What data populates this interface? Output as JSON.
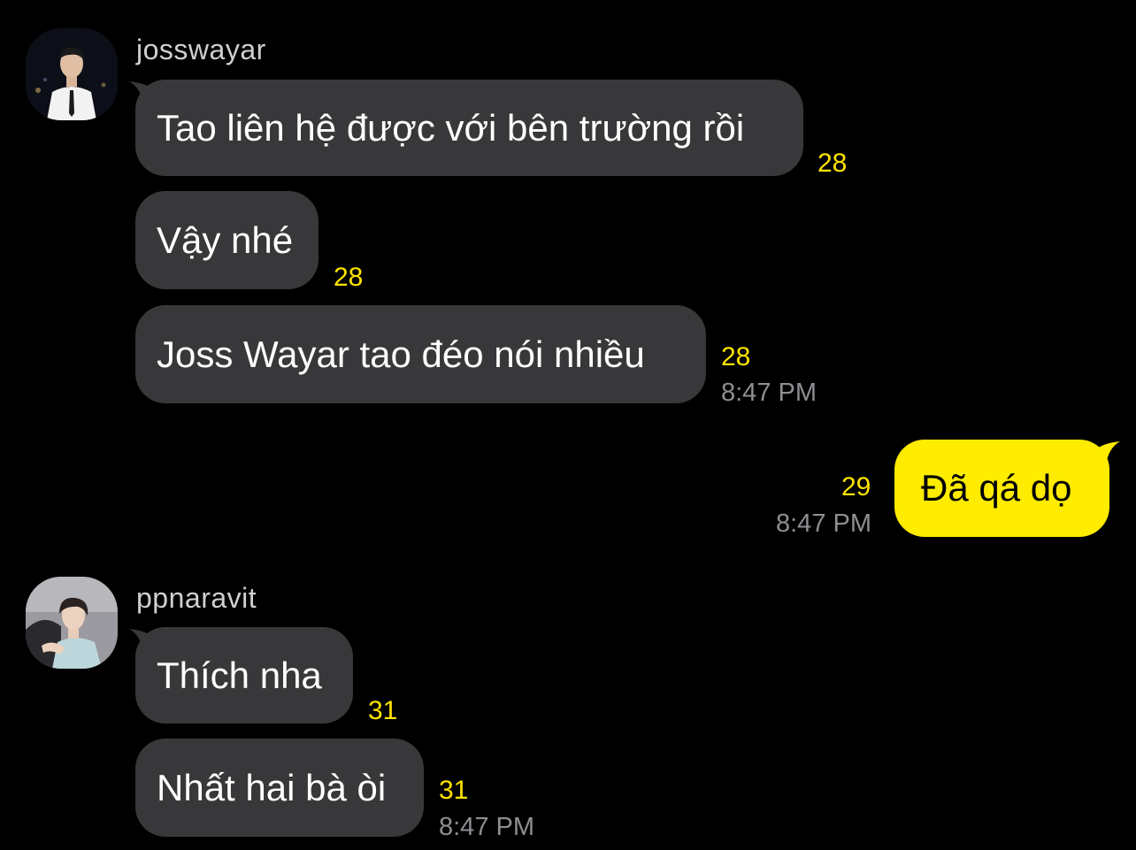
{
  "colors": {
    "background": "#000000",
    "incoming_bubble": "#38383a",
    "outgoing_bubble": "#ffec00",
    "unread_count": "#ffe300",
    "timestamp": "#8e8e93"
  },
  "groups": [
    {
      "sender": "josswayar",
      "avatar_icon": "profile-photo-josswayar",
      "messages": [
        {
          "text": "Tao liên hệ được với bên trường rồi",
          "unread": "28"
        },
        {
          "text": "Vậy nhé",
          "unread": "28"
        },
        {
          "text": "Joss Wayar tao đéo nói nhiều",
          "unread": "28",
          "time": "8:47 PM"
        }
      ]
    },
    {
      "sender": "",
      "outgoing": true,
      "messages": [
        {
          "text": "Đã qá dọ",
          "unread": "29",
          "time": "8:47 PM"
        }
      ]
    },
    {
      "sender": "ppnaravit",
      "avatar_icon": "profile-photo-ppnaravit",
      "messages": [
        {
          "text": "Thích nha",
          "unread": "31"
        },
        {
          "text": "Nhất hai bà òi",
          "unread": "31",
          "time": "8:47 PM"
        }
      ]
    }
  ]
}
